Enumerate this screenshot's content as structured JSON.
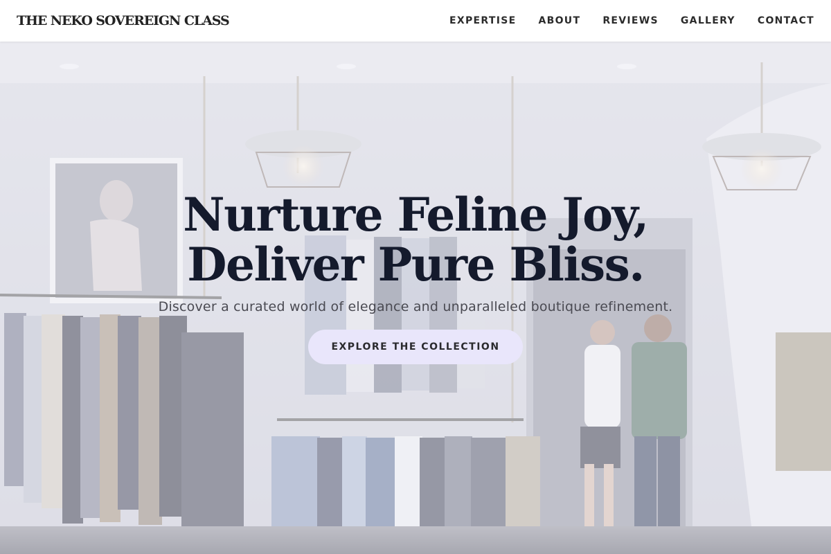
{
  "brand": "THE NEKO SOVEREIGN CLASS",
  "nav": {
    "items": [
      "EXPERTISE",
      "ABOUT",
      "REVIEWS",
      "GALLERY",
      "CONTACT"
    ]
  },
  "hero": {
    "headline_line1": "Nurture Feline Joy,",
    "headline_line2": "Deliver Pure Bliss.",
    "subline": "Discover a curated world of elegance and unparalleled boutique refinement.",
    "cta_label": "EXPLORE THE COLLECTION",
    "background": "boutique-interior-photo"
  },
  "colors": {
    "header_bg": "#ffffff",
    "headline": "#141a2c",
    "cta_bg": "#e9e6fb",
    "cta_text": "#2a2a2e"
  }
}
